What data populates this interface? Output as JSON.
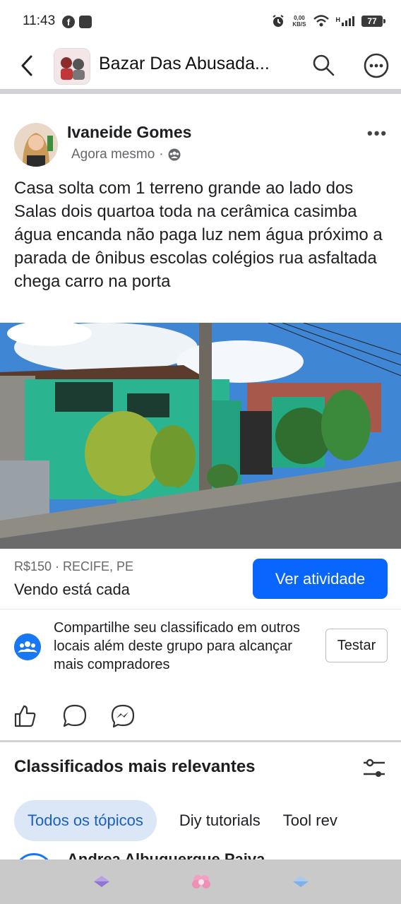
{
  "status_bar": {
    "time": "11:43",
    "speed_value": "0,00",
    "speed_unit": "KB/S",
    "network": "H",
    "battery": "77"
  },
  "header": {
    "title": "Bazar Das Abusada...",
    "icons": [
      "back-arrow-icon",
      "search-icon",
      "more-options-icon"
    ]
  },
  "post": {
    "author": "Ivaneide Gomes",
    "timestamp": "Agora mesmo",
    "separator": "·",
    "text": "Casa solta com 1 terreno grande ao lado dos Salas dois quartoa toda na cerâmica casimba água encanda não paga luz nem água próximo a parada de ônibus escolas colégios rua asfaltada chega carro na porta",
    "price_location": "R$150 · RECIFE, PE",
    "item_title": "Vendo está cada",
    "primary_button": "Ver atividade"
  },
  "share_prompt": {
    "text": "Compartilhe seu classificado em outros locais além deste grupo para alcançar mais compradores",
    "button": "Testar"
  },
  "actions": [
    "like-icon",
    "comment-icon",
    "messenger-icon"
  ],
  "section": {
    "title": "Classificados mais relevantes",
    "chips": [
      "Todos os tópicos",
      "Diy tutorials",
      "Tool rev"
    ],
    "next_author": "Andrea Albuquerque Paiva"
  },
  "colors": {
    "accent": "#0866ff",
    "chip_active_bg": "#dbe7f7",
    "chip_active_text": "#1a5fc6",
    "divider": "#d0d2d5"
  }
}
